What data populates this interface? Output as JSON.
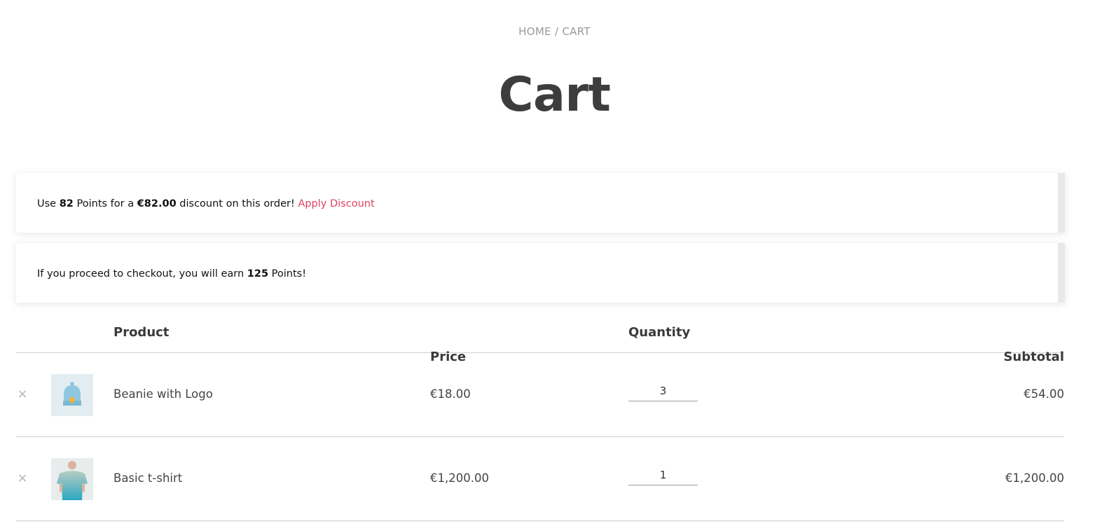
{
  "breadcrumb": {
    "home": "HOME",
    "separator": " / ",
    "current": "CART"
  },
  "page_title": "Cart",
  "notices": {
    "discount": {
      "prefix": "Use ",
      "points": "82",
      "middle": " Points for a ",
      "amount": "€82.00",
      "suffix": " discount on this order! ",
      "link": "Apply Discount"
    },
    "earn": {
      "prefix": "If you proceed to checkout, you will earn ",
      "points": "125",
      "suffix": " Points!"
    }
  },
  "table": {
    "headers": {
      "product": "Product",
      "price": "Price",
      "quantity": "Quantity",
      "subtotal": "Subtotal"
    },
    "rows": [
      {
        "name": "Beanie with Logo",
        "price": "€18.00",
        "quantity": "3",
        "subtotal": "€54.00",
        "remove_icon": "×",
        "thumb_icon": "beanie-icon"
      },
      {
        "name": "Basic t-shirt",
        "price": "€1,200.00",
        "quantity": "1",
        "subtotal": "€1,200.00",
        "remove_icon": "×",
        "thumb_icon": "tshirt-icon"
      }
    ]
  },
  "colors": {
    "link": "#e0415f",
    "title": "#3d3d3d",
    "muted": "#9a9a9a"
  }
}
